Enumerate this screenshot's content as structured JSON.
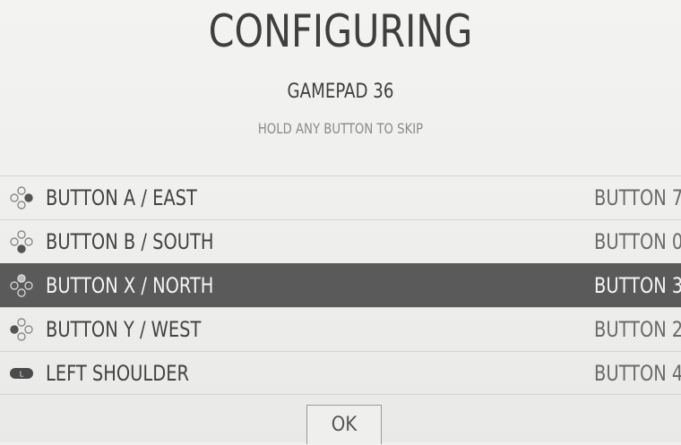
{
  "header": {
    "title": "CONFIGURING",
    "device": "GAMEPAD 36",
    "hint": "HOLD ANY BUTTON TO SKIP"
  },
  "mappings": [
    {
      "label": "BUTTON A / EAST",
      "value": "BUTTON 7",
      "icon": "dpad-east-icon",
      "selected": false
    },
    {
      "label": "BUTTON B / SOUTH",
      "value": "BUTTON 0",
      "icon": "dpad-south-icon",
      "selected": false
    },
    {
      "label": "BUTTON X / NORTH",
      "value": "BUTTON 3",
      "icon": "dpad-north-icon",
      "selected": true
    },
    {
      "label": "BUTTON Y / WEST",
      "value": "BUTTON 2",
      "icon": "dpad-west-icon",
      "selected": false
    },
    {
      "label": "LEFT SHOULDER",
      "value": "BUTTON 4",
      "icon": "left-shoulder-icon",
      "icon_text": "L",
      "selected": false
    }
  ],
  "ok_button": {
    "label": "OK"
  },
  "colors": {
    "background": "#f1f1ef",
    "selected_row": "#5a5a5a",
    "text": "#434343"
  }
}
